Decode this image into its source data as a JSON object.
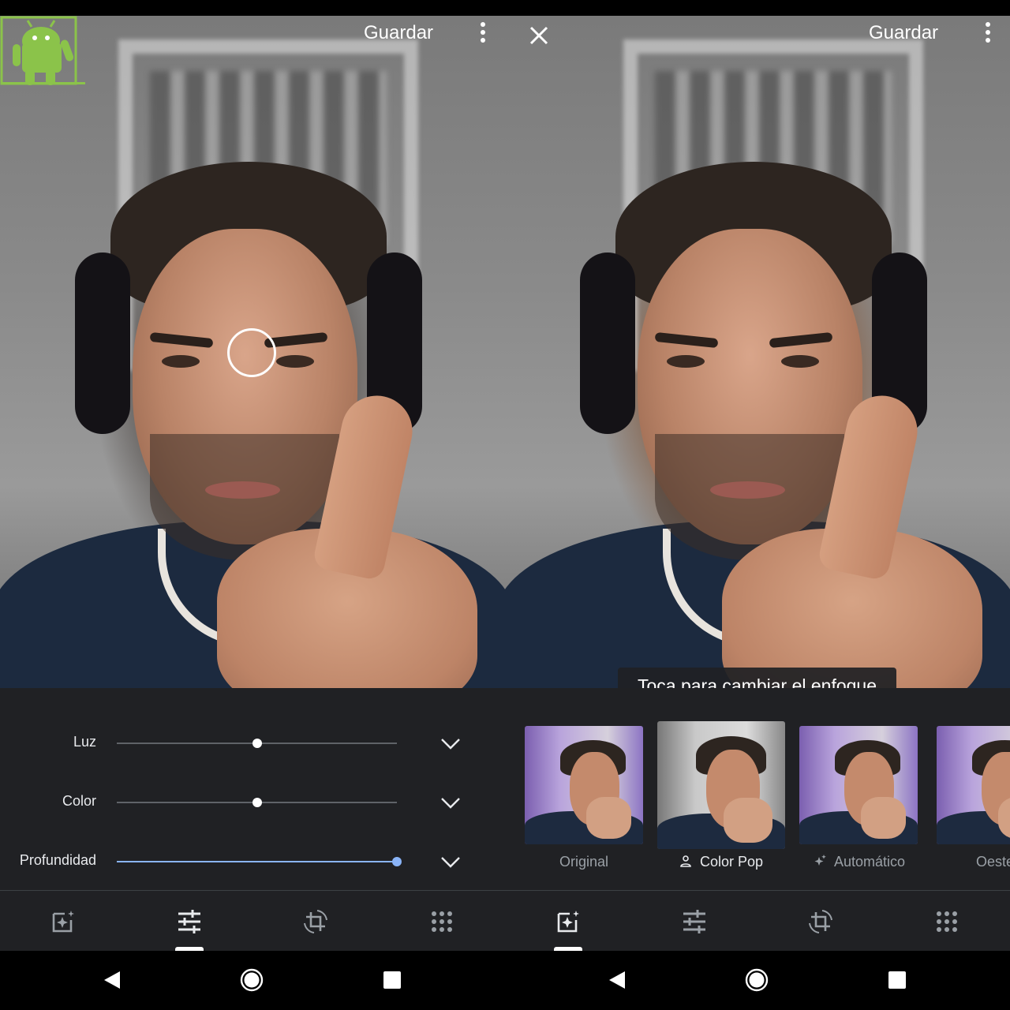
{
  "left_pane": {
    "save_label": "Guardar",
    "sliders": [
      {
        "label": "Luz",
        "value": 0.5,
        "active": false
      },
      {
        "label": "Color",
        "value": 0.5,
        "active": false
      },
      {
        "label": "Profundidad",
        "value": 1.0,
        "active": true
      }
    ],
    "active_tab": "adjust"
  },
  "right_pane": {
    "save_label": "Guardar",
    "toast": "Toca para cambiar el enfoque",
    "filters": [
      {
        "label": "Original",
        "icon": "",
        "selected": false
      },
      {
        "label": "Color Pop",
        "icon": "person-icon",
        "selected": true
      },
      {
        "label": "Automático",
        "icon": "sparkle-icon",
        "selected": false
      },
      {
        "label": "Oeste",
        "icon": "",
        "selected": false
      }
    ],
    "active_tab": "suggestions"
  },
  "tabs": [
    {
      "name": "suggestions",
      "icon": "auto-fix-icon"
    },
    {
      "name": "adjust",
      "icon": "tune-icon"
    },
    {
      "name": "crop",
      "icon": "crop-rotate-icon"
    },
    {
      "name": "more",
      "icon": "apps-grid-icon"
    }
  ],
  "colors": {
    "panel": "#202124",
    "accent": "#8ab4f8",
    "track": "#5f6368"
  }
}
